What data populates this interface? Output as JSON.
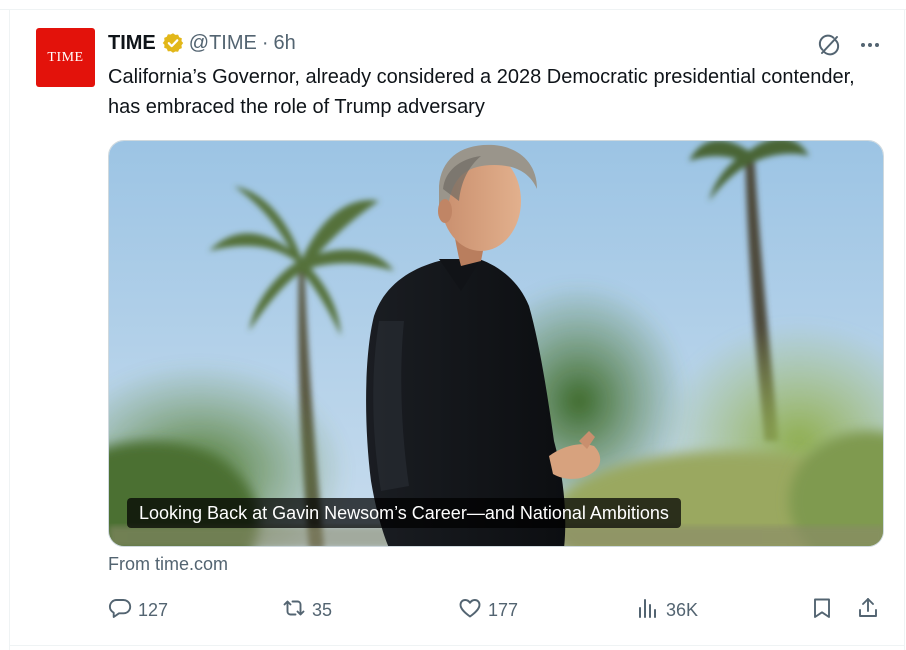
{
  "tweet": {
    "avatar_text": "TIME",
    "author_name": "TIME",
    "handle": "@TIME",
    "separator": "·",
    "time": "6h",
    "text": "California’s Governor, already considered a 2028 Democratic presidential contender, has embraced the role of Trump adversary"
  },
  "card": {
    "title": "Looking Back at Gavin Newsom’s Career—and National Ambitions",
    "source": "From time.com"
  },
  "actions": {
    "replies": "127",
    "reposts": "35",
    "likes": "177",
    "views": "36K"
  },
  "icons": {
    "verified": "verified-badge-icon",
    "grok": "grok-icon",
    "more": "more-icon",
    "reply": "reply-icon",
    "repost": "repost-icon",
    "like": "like-icon",
    "views": "views-icon",
    "bookmark": "bookmark-icon",
    "share": "share-icon"
  },
  "colors": {
    "text": "#0f1419",
    "secondary": "#536471",
    "verified_gold": "#e2b719",
    "time_red": "#e3120b"
  }
}
